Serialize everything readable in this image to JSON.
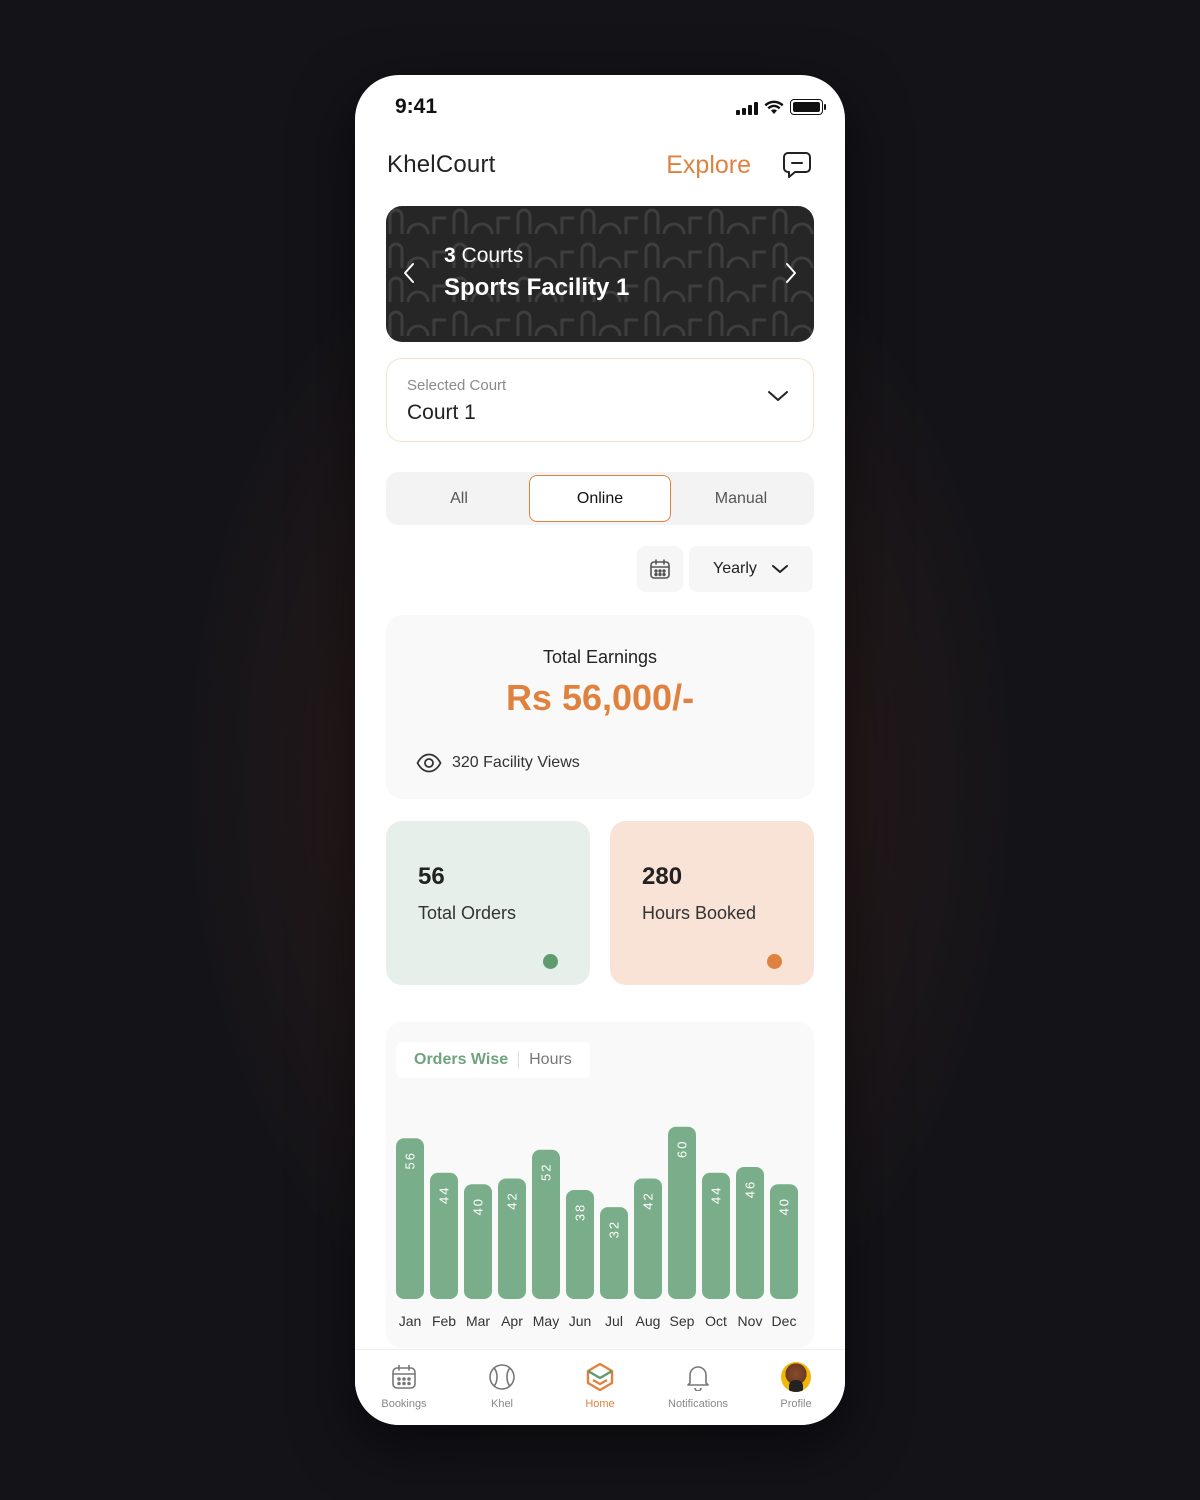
{
  "status_bar": {
    "time": "9:41"
  },
  "header": {
    "app_name": "KhelCourt",
    "explore_label": "Explore"
  },
  "facility": {
    "court_count": "3",
    "court_word": "Courts",
    "name": "Sports Facility 1"
  },
  "court_select": {
    "label": "Selected Court",
    "value": "Court 1"
  },
  "segments": [
    {
      "label": "All"
    },
    {
      "label": "Online"
    },
    {
      "label": "Manual"
    }
  ],
  "active_segment": "Online",
  "filter": {
    "period": "Yearly"
  },
  "earnings": {
    "title": "Total Earnings",
    "amount": "Rs 56,000/-",
    "views": "320 Facility Views"
  },
  "stats": {
    "orders": {
      "value": "56",
      "label": "Total Orders",
      "color": "#5f9b6e"
    },
    "hours": {
      "value": "280",
      "label": "Hours Booked",
      "color": "#e0823f"
    }
  },
  "chart_tabs": {
    "active": "Orders Wise",
    "inactive": "Hours"
  },
  "chart_data": {
    "type": "bar",
    "categories": [
      "Jan",
      "Feb",
      "Mar",
      "Apr",
      "May",
      "Jun",
      "Jul",
      "Aug",
      "Sep",
      "Oct",
      "Nov",
      "Dec"
    ],
    "values": [
      56,
      44,
      40,
      42,
      52,
      38,
      32,
      42,
      60,
      44,
      46,
      40
    ],
    "bar_color": "#7aae8a",
    "grid": false
  },
  "nav": [
    {
      "label": "Bookings",
      "icon": "calendar-icon"
    },
    {
      "label": "Khel",
      "icon": "ball-icon"
    },
    {
      "label": "Home",
      "icon": "home-icon"
    },
    {
      "label": "Notifications",
      "icon": "bell-icon"
    },
    {
      "label": "Profile",
      "icon": "avatar"
    }
  ],
  "colors": {
    "accent": "#e0823f",
    "green": "#7aae8a",
    "card_dark": "#262626"
  }
}
